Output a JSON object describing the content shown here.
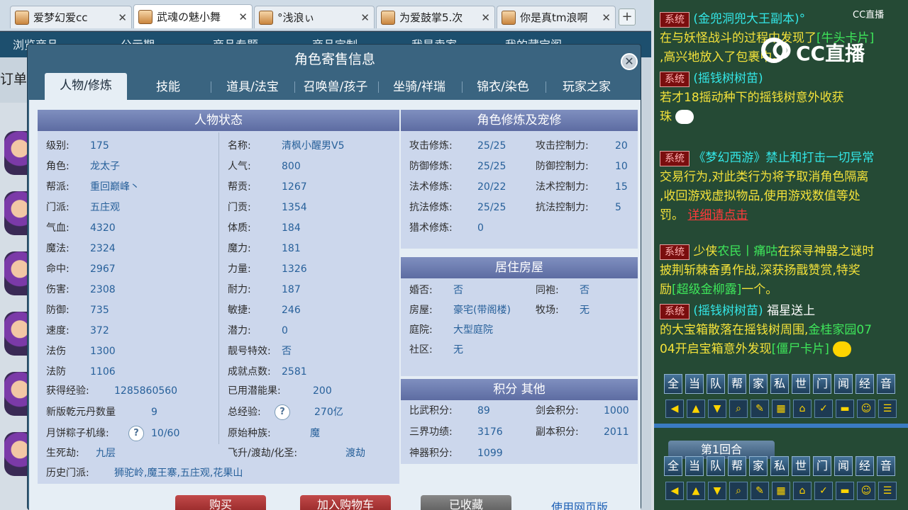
{
  "browser": {
    "tabs": [
      {
        "title": "爱梦幻爱cc",
        "active": false
      },
      {
        "title": "武魂の魅小舞",
        "active": true
      },
      {
        "title": "°浅浪ぃ",
        "active": false
      },
      {
        "title": "为爱鼓掌5.次",
        "active": false
      },
      {
        "title": "你是真tm浪啊",
        "active": false
      }
    ],
    "close_glyph": "✕",
    "newtab_glyph": "+"
  },
  "site": {
    "nav": [
      "浏览商品",
      "公示期",
      "商品专题",
      "商品定制",
      "我是卖家",
      "我的藏宝阁"
    ],
    "order_stub": "订单"
  },
  "modal": {
    "title": "角色寄售信息",
    "close_glyph": "✕",
    "tabs": [
      "人物/修炼",
      "技能",
      "道具/法宝",
      "召唤兽/孩子",
      "坐骑/祥瑞",
      "锦衣/染色",
      "玩家之家"
    ],
    "status": {
      "header": "人物状态",
      "left": [
        {
          "label": "级别:",
          "value": "175"
        },
        {
          "label": "角色:",
          "value": "龙太子"
        },
        {
          "label": "帮派:",
          "value": "重回巅峰丶"
        },
        {
          "label": "门派:",
          "value": "五庄观"
        },
        {
          "label": "气血:",
          "value": "4320"
        },
        {
          "label": "魔法:",
          "value": "2324"
        },
        {
          "label": "命中:",
          "value": "2967"
        },
        {
          "label": "伤害:",
          "value": "2308"
        },
        {
          "label": "防御:",
          "value": "735"
        },
        {
          "label": "速度:",
          "value": "372"
        },
        {
          "label": "法伤",
          "value": "1300"
        },
        {
          "label": "法防",
          "value": "1106"
        }
      ],
      "right": [
        {
          "label": "名称:",
          "value": "清枫小醒男V5"
        },
        {
          "label": "人气:",
          "value": "800"
        },
        {
          "label": "帮贡:",
          "value": "1267"
        },
        {
          "label": "门贡:",
          "value": "1354"
        },
        {
          "label": "体质:",
          "value": "184"
        },
        {
          "label": "魔力:",
          "value": "181"
        },
        {
          "label": "力量:",
          "value": "1326"
        },
        {
          "label": "耐力:",
          "value": "187"
        },
        {
          "label": "敏捷:",
          "value": "246"
        },
        {
          "label": "潜力:",
          "value": "0"
        },
        {
          "label": "靓号特效:",
          "value": "否"
        },
        {
          "label": "成就点数:",
          "value": "2581"
        }
      ],
      "exp_label": "获得经验:",
      "exp_value": "1285860560",
      "used_potential_label": "已用潜能果:",
      "used_potential_value": "200",
      "qyd_label": "新版乾元丹数量",
      "qyd_value": "9",
      "total_exp_label": "总经验:",
      "total_exp_value": "270亿",
      "mooncake_label": "月饼粽子机缘:",
      "mooncake_value": "10/60",
      "race_label": "原始种族:",
      "race_value": "魔",
      "life_death_label": "生死劫:",
      "life_death_value": "九层",
      "ascend_label": "飞升/渡劫/化圣:",
      "ascend_value": "渡劫",
      "history_label": "历史门派:",
      "history_value": "狮驼岭,魔王寨,五庄观,花果山",
      "help_glyph": "?"
    },
    "cultivation": {
      "header": "角色修炼及宠修",
      "left": [
        {
          "label": "攻击修炼:",
          "value": "25/25"
        },
        {
          "label": "防御修炼:",
          "value": "25/25"
        },
        {
          "label": "法术修炼:",
          "value": "20/22"
        },
        {
          "label": "抗法修炼:",
          "value": "25/25"
        },
        {
          "label": "猎术修炼:",
          "value": "0"
        }
      ],
      "right": [
        {
          "label": "攻击控制力:",
          "value": "20"
        },
        {
          "label": "防御控制力:",
          "value": "10"
        },
        {
          "label": "法术控制力:",
          "value": "15"
        },
        {
          "label": "抗法控制力:",
          "value": "5"
        }
      ]
    },
    "housing": {
      "header": "居住房屋",
      "left": [
        {
          "label": "婚否:",
          "value": "否"
        },
        {
          "label": "房屋:",
          "value": "豪宅(带阁楼)"
        },
        {
          "label": "庭院:",
          "value": "大型庭院"
        },
        {
          "label": "社区:",
          "value": "无"
        }
      ],
      "right": [
        {
          "label": "同袍:",
          "value": "否"
        },
        {
          "label": "牧场:",
          "value": "无"
        }
      ]
    },
    "points": {
      "header": "积分 其他",
      "left": [
        {
          "label": "比武积分:",
          "value": "89"
        },
        {
          "label": "三界功绩:",
          "value": "3176"
        },
        {
          "label": "神器积分:",
          "value": "1099"
        }
      ],
      "right": [
        {
          "label": "剑会积分:",
          "value": "1000"
        },
        {
          "label": "副本积分:",
          "value": "2011"
        }
      ]
    },
    "buttons": {
      "buy": "购买",
      "cart": "加入购物车",
      "saved": "已收藏",
      "web": "使用网页版"
    }
  },
  "chat": {
    "brand": "CC直播",
    "brand_small": "CC直播",
    "sys_tag": "系统",
    "msg1_a": "(金兜洞兜大王副本)°",
    "msg1_b": "在与妖怪战斗的过程中发现了",
    "msg1_c": "[牛头卡片]",
    "msg1_d": ",高兴地放入了包裹中。",
    "msg2_a": "(摇钱树树苗)",
    "msg2_b": "若才18摇动种下的摇钱树意外收获",
    "msg2_c": "珠",
    "msg3_a": "《梦幻西游》禁止和打击一切异常",
    "msg3_b": "交易行为,对此类行为将予取消角色隔离",
    "msg3_c": ",收回游戏虚拟物品,使用游戏数值等处",
    "msg3_d": "罚。",
    "msg3_e": "详细请点击",
    "msg4_a": "少侠",
    "msg4_b": "农民丨痛咕",
    "msg4_c": "在探寻神器之谜时",
    "msg4_d": "披荆斩棘奋勇作战,深获扬戬赞赏,特奖",
    "msg4_e": "励",
    "msg4_f": "[超级金柳露]",
    "msg4_g": "一个。",
    "msg5_a": "(摇钱树树苗)",
    "msg5_b": "福星送上",
    "msg5_c": "的大宝箱散落在摇钱树周围,",
    "msg5_d": "金桂家园07",
    "msg5_e": "04开启宝箱意外发现",
    "msg5_f": "[僵尸卡片]",
    "channels": [
      "全",
      "当",
      "队",
      "帮",
      "家",
      "私",
      "世",
      "门",
      "闻",
      "经",
      "音"
    ],
    "tool_icons": [
      "left-arrow-icon",
      "up-arrow-icon",
      "down-arrow-icon",
      "magnifier-icon",
      "note-icon",
      "grid-icon",
      "lock-icon",
      "broom-icon",
      "folder-icon",
      "speech-icon",
      "list-icon"
    ],
    "tool_glyphs": [
      "◀",
      "▲",
      "▼",
      "⌕",
      "✎",
      "▦",
      "⌂",
      "✓",
      "▬",
      "☺",
      "☰"
    ],
    "round": "第1回合"
  }
}
